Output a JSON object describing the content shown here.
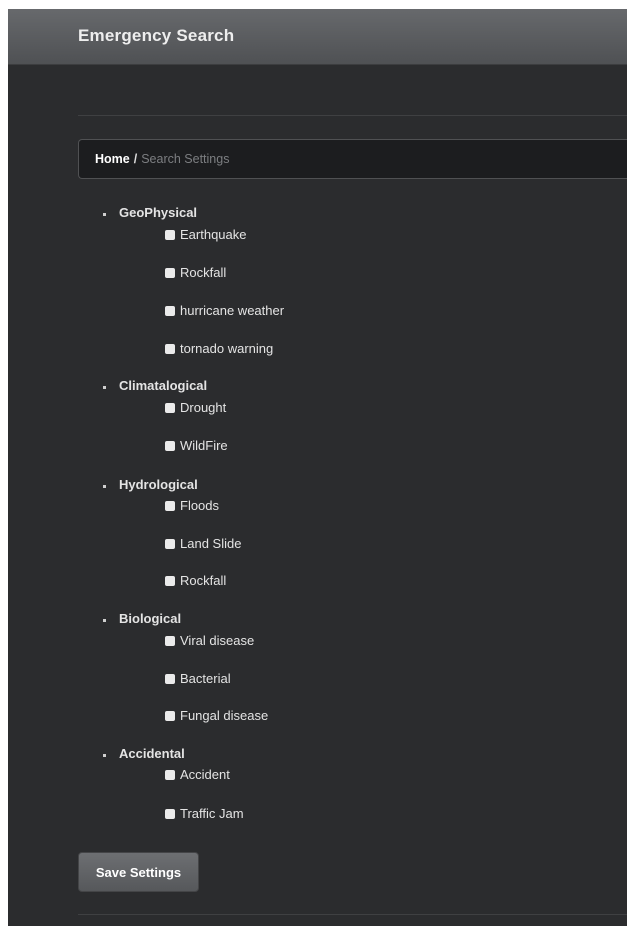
{
  "app_title": "Emergency Search",
  "breadcrumb": {
    "home": "Home",
    "separator": "/",
    "current": "Search Settings"
  },
  "categories": [
    {
      "label": "GeoPhysical",
      "options": [
        "Earthquake",
        "Rockfall",
        "hurricane weather",
        "tornado warning"
      ]
    },
    {
      "label": "Climatalogical",
      "options": [
        "Drought",
        "WildFire"
      ]
    },
    {
      "label": "Hydrological",
      "options": [
        "Floods",
        "Land Slide",
        "Rockfall"
      ]
    },
    {
      "label": "Biological",
      "options": [
        "Viral disease",
        "Bacterial",
        "Fungal disease"
      ]
    },
    {
      "label": "Accidental",
      "options": [
        "Accident",
        "Traffic Jam"
      ]
    }
  ],
  "save_button": "Save Settings",
  "colors": {
    "background": "#2b2c2e",
    "navbar": "#5a5c5f",
    "breadcrumb_bg": "#1c1d1f",
    "text": "#e4e4e4",
    "muted_text": "#7c7e81"
  }
}
